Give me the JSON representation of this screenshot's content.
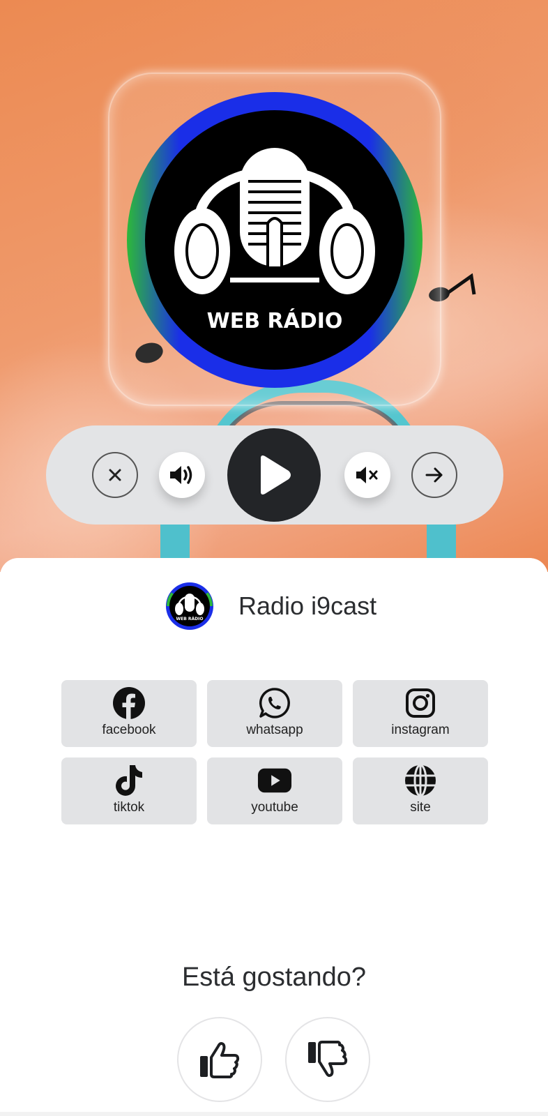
{
  "cover": {
    "logo_text": "WEB RÁDIO",
    "logo_ring_colors": [
      "#1a2ee8",
      "#2db83a"
    ]
  },
  "player": {
    "buttons": [
      {
        "name": "close",
        "icon": "close-icon"
      },
      {
        "name": "volume-up",
        "icon": "volume-up-icon"
      },
      {
        "name": "play",
        "icon": "play-icon"
      },
      {
        "name": "mute",
        "icon": "mute-icon"
      },
      {
        "name": "next",
        "icon": "arrow-right-icon"
      }
    ]
  },
  "station": {
    "name": "Radio i9cast",
    "logo_text": "WEB RÁDIO"
  },
  "social": [
    {
      "label": "facebook",
      "icon": "facebook-icon"
    },
    {
      "label": "whatsapp",
      "icon": "whatsapp-icon"
    },
    {
      "label": "instagram",
      "icon": "instagram-icon"
    },
    {
      "label": "tiktok",
      "icon": "tiktok-icon"
    },
    {
      "label": "youtube",
      "icon": "youtube-icon"
    },
    {
      "label": "site",
      "icon": "globe-icon"
    }
  ],
  "feedback": {
    "question": "Está gostando?",
    "like_icon": "thumbs-up-icon",
    "dislike_icon": "thumbs-down-icon"
  },
  "colors": {
    "hero_orange": "#ec8a52",
    "player_bar": "#e3e4e6",
    "play_button": "#232528",
    "social_tile": "#e2e3e5",
    "text_dark": "#2b2d30"
  }
}
